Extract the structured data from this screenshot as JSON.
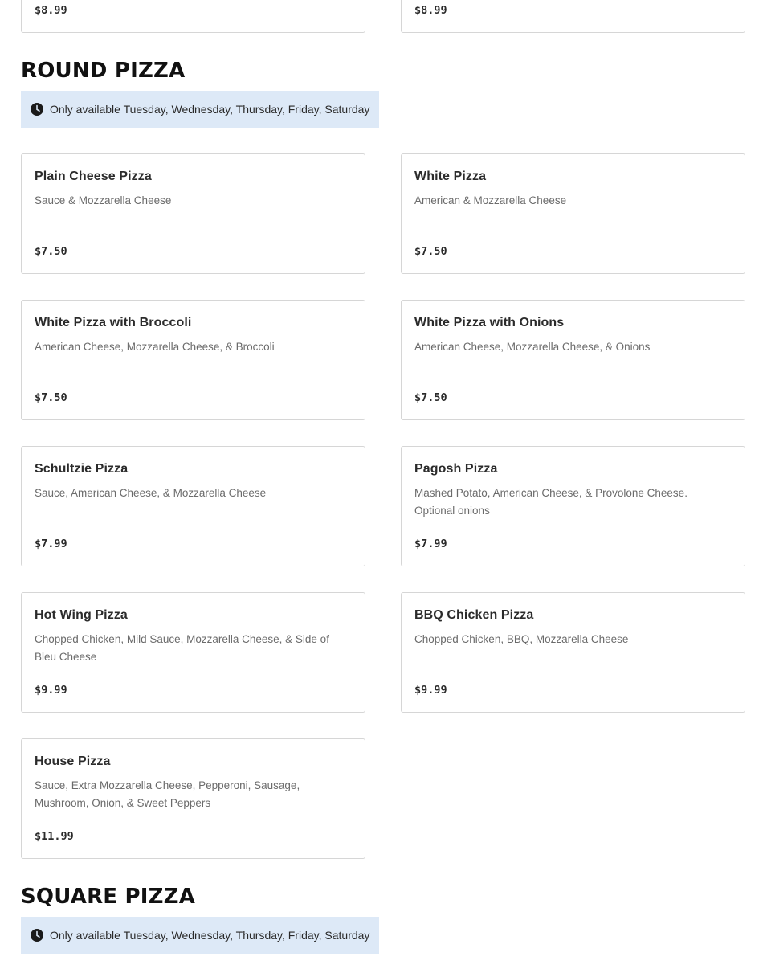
{
  "top_cards": [
    {
      "price": "$8.99"
    },
    {
      "price": "$8.99"
    }
  ],
  "round_pizza": {
    "title": "ROUND PIZZA",
    "notice": "Only available Tuesday, Wednesday, Thursday, Friday, Saturday",
    "items": [
      {
        "name": "Plain Cheese Pizza",
        "description": "Sauce & Mozzarella Cheese",
        "price": "$7.50"
      },
      {
        "name": "White Pizza",
        "description": "American & Mozzarella Cheese",
        "price": "$7.50"
      },
      {
        "name": "White Pizza with Broccoli",
        "description": "American Cheese, Mozzarella Cheese, & Broccoli",
        "price": "$7.50"
      },
      {
        "name": "White Pizza with Onions",
        "description": "American Cheese, Mozzarella Cheese, & Onions",
        "price": "$7.50"
      },
      {
        "name": "Schultzie Pizza",
        "description": "Sauce, American Cheese, & Mozzarella Cheese",
        "price": "$7.99"
      },
      {
        "name": "Pagosh Pizza",
        "description": "Mashed Potato, American Cheese, & Provolone Cheese. Optional onions",
        "price": "$7.99"
      },
      {
        "name": "Hot Wing Pizza",
        "description": "Chopped Chicken, Mild Sauce, Mozzarella Cheese, & Side of Bleu Cheese",
        "price": "$9.99"
      },
      {
        "name": "BBQ Chicken Pizza",
        "description": "Chopped Chicken, BBQ, Mozzarella Cheese",
        "price": "$9.99"
      },
      {
        "name": "House Pizza",
        "description": "Sauce, Extra Mozzarella Cheese, Pepperoni, Sausage, Mushroom, Onion, & Sweet Peppers",
        "price": "$11.99"
      }
    ]
  },
  "square_pizza": {
    "title": "SQUARE PIZZA",
    "notice": "Only available Tuesday, Wednesday, Thursday, Friday, Saturday"
  },
  "icons": {
    "notice": "clock-icon"
  },
  "colors": {
    "notice_bg": "#dde9f7",
    "card_border": "#d6d6d6",
    "muted_text": "#6b6b6b"
  }
}
